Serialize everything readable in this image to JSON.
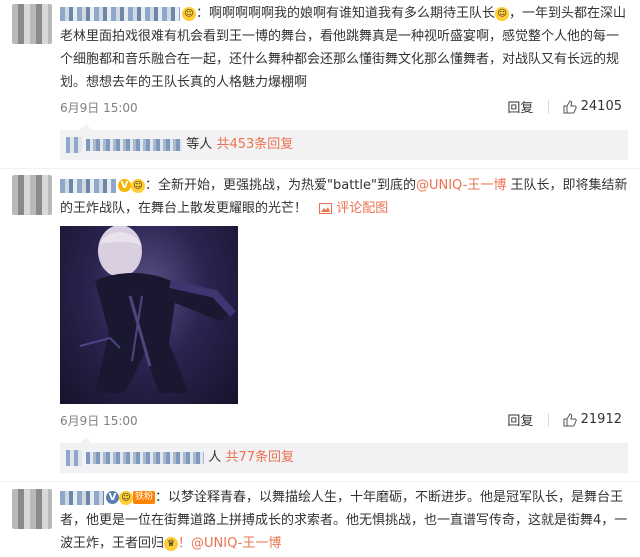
{
  "comments": [
    {
      "text_start": "：啊啊啊啊啊我的娘啊有谁知道我有多么期待王队长",
      "text_rest": "，一年到头都在深山老林里面拍戏很难有机会看到王一博的舞台，看他跳舞真是一种视听盛宴啊，感觉整个人他的每一个细胞都和音乐融合在一起，还什么舞种都会还那么懂街舞文化那么懂舞者，对战队又有长远的规划。想想去年的王队长真的人格魅力爆棚啊",
      "time": "6月9日 15:00",
      "reply_label": "回复",
      "likes": "24105",
      "replies_text": "等人",
      "replies_link": "共453条回复"
    },
    {
      "text_start": "：全新开始，更强挑战，为热爱\"battle\"到底的",
      "mention": "@UNIQ-王一博",
      "text_rest": " 王队长，即将集结新的王炸战队，在舞台上散发更耀眼的光芒！",
      "image_link": "评论配图",
      "time": "6月9日 15:00",
      "reply_label": "回复",
      "likes": "21912",
      "replies_text": "人",
      "replies_link": "共77条回复"
    },
    {
      "level_badge": "铁粉",
      "text": "：以梦诠释青春，以舞描绘人生，十年磨砺，不断进步。他是冠军队长，是舞台王者，他更是一位在街舞道路上拼搏成长的求索者。他无惧挑战，也一直谱写传奇，这就是街舞4，一波王炸，王者回归",
      "mention": "！@UNIQ-王一博"
    }
  ],
  "icons": {
    "verified": "verified-v-icon",
    "thumb": "thumbs-up-icon",
    "image": "picture-icon",
    "emoji": "smile-emoji-icon"
  },
  "colors": {
    "link": "#eb7350",
    "verified": "#f6b500",
    "reply_bg": "#f2f2f5"
  }
}
